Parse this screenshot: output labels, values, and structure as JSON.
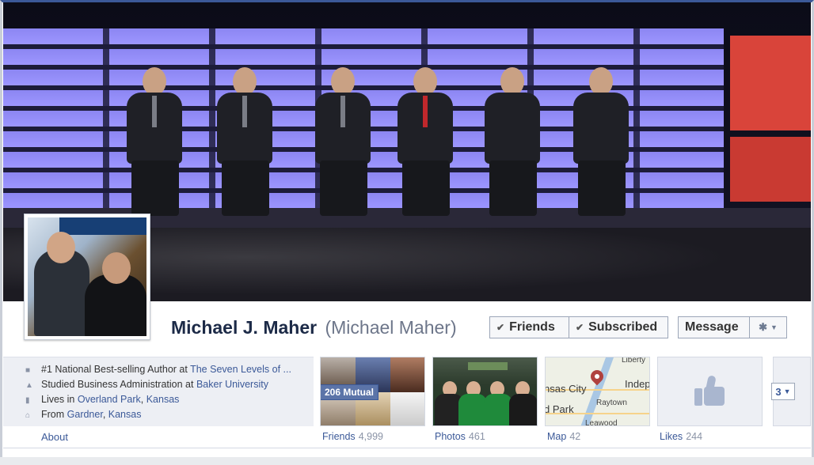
{
  "profile": {
    "name": "Michael J. Maher",
    "alternate_name": "(Michael Maher)"
  },
  "actions": {
    "friends_label": "Friends",
    "subscribed_label": "Subscribed",
    "message_label": "Message",
    "check_glyph": "✔",
    "gear_glyph": "✱",
    "caret_glyph": "▼"
  },
  "info": {
    "work": {
      "prefix": "#1 National Best-selling Author at ",
      "link": "The Seven Levels of ..."
    },
    "education": {
      "prefix": "Studied Business Administration at ",
      "link": "Baker University"
    },
    "lives": {
      "prefix": "Lives in ",
      "city": "Overland Park",
      "sep": ", ",
      "state": "Kansas"
    },
    "from": {
      "prefix": "From ",
      "city": "Gardner",
      "sep": ", ",
      "state": "Kansas"
    },
    "about_label": "About"
  },
  "tiles": {
    "friends": {
      "label": "Friends",
      "count": "4,999",
      "mutual": "206 Mutual"
    },
    "photos": {
      "label": "Photos",
      "count": "461"
    },
    "map": {
      "label": "Map",
      "count": "42",
      "city_text": "nsas City",
      "indep_text": "Indep",
      "liberty_text": "Liberty",
      "raytown_text": "Raytown",
      "park_text": "d Park",
      "leawood_text": "Leawood"
    },
    "likes": {
      "label": "Likes",
      "count": "244"
    },
    "more": {
      "count": "3"
    }
  },
  "icons": [
    "briefcase-icon",
    "graduation-cap-icon",
    "city-icon",
    "house-icon",
    "check-icon",
    "gear-icon",
    "chevron-down-icon",
    "thumbs-up-icon",
    "map-pin-icon"
  ],
  "colors": {
    "brand": "#3b5998",
    "name": "#1c2a47",
    "cover_stage_light": "#9d96ff",
    "cover_red": "#d9443a"
  }
}
